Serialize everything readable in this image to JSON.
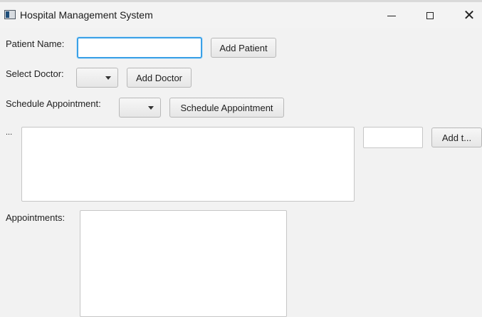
{
  "window": {
    "title": "Hospital Management System",
    "icon": "app-window-icon"
  },
  "patient": {
    "label": "Patient Name:",
    "input_value": "",
    "add_button": "Add Patient"
  },
  "doctor": {
    "label": "Select Doctor:",
    "selected": "",
    "add_button": "Add Doctor"
  },
  "appointment": {
    "label": "Schedule Appointment:",
    "selected": "",
    "schedule_button": "Schedule Appointment"
  },
  "notes": {
    "label": "...",
    "text": "",
    "side_input_value": "",
    "add_button": "Add t..."
  },
  "appointments": {
    "label": "Appointments:",
    "items": []
  }
}
